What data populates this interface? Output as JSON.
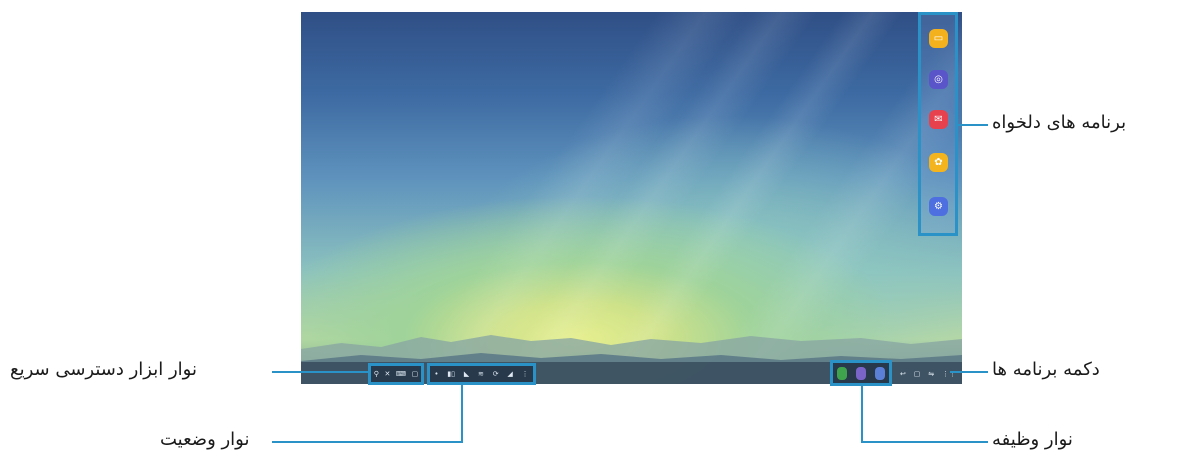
{
  "labels": {
    "favorite_apps": "برنامه های دلخواه",
    "apps_button": "دکمه برنامه ها",
    "quick_access_toolbar": "نوار ابزار دسترسی سریع",
    "status_bar": "نوار وضعیت",
    "taskbar": "نوار وظیفه"
  },
  "favorite_apps": [
    {
      "icon": "folder-icon",
      "color": "#f3b21d"
    },
    {
      "icon": "internet-icon",
      "color": "#5a55c9"
    },
    {
      "icon": "email-icon",
      "color": "#e8414e"
    },
    {
      "icon": "gallery-icon",
      "color": "#f4b41e"
    },
    {
      "icon": "settings-icon",
      "color": "#4d6fe0"
    }
  ],
  "quick_access_icons": [
    "search-icon",
    "screen-capture-icon",
    "keyboard-icon",
    "window-icon"
  ],
  "status_icons": [
    "notification-icon",
    "battery-icon",
    "signal-icon",
    "wifi-icon",
    "sync-icon",
    "volume-icon",
    "more-icon"
  ],
  "taskbar_apps": [
    {
      "icon": "android-app-icon",
      "color": "#3fa34d"
    },
    {
      "icon": "browser-app-icon",
      "color": "#7a64c8"
    },
    {
      "icon": "phone-app-icon",
      "color": "#5b7fd6"
    }
  ],
  "nav_icons": [
    "back-icon",
    "home-icon",
    "recent-icon",
    "apps-grid-icon"
  ],
  "colors": {
    "highlight": "#2a92c6"
  }
}
